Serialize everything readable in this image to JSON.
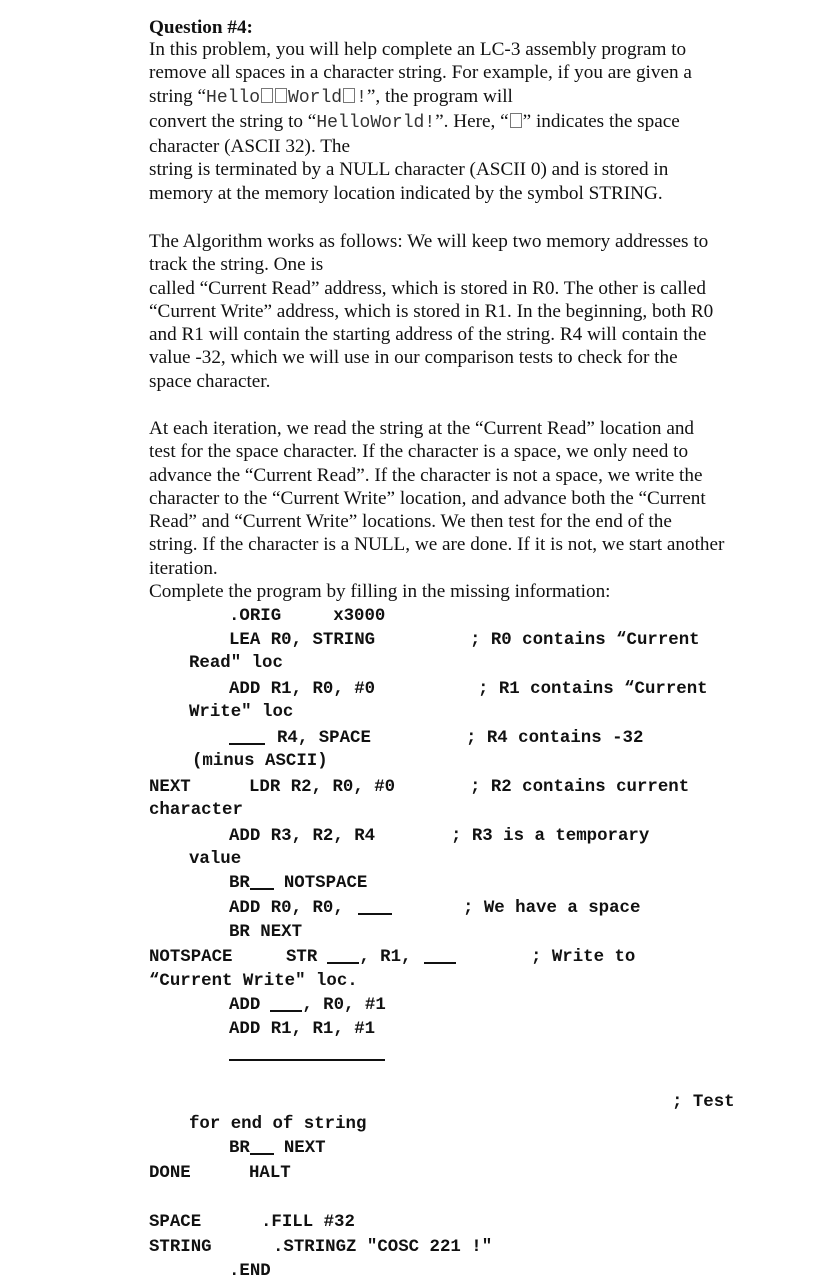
{
  "question": {
    "title": "Question #4:",
    "intro": {
      "line1": "In this problem, you will help complete an LC-3 assembly program to",
      "line2": "remove all spaces in a character string. For example, if you are given a",
      "line3_prefix": "string “",
      "example_input_hello": "Hello",
      "example_input_world": "World",
      "example_input_bang": "!",
      "line3_suffix": "”, the program will",
      "line4_prefix": "convert the string to “",
      "example_output": "HelloWorld!",
      "line4_mid": "”. Here, “",
      "line4_suffix": "” indicates the space",
      "line5": "character (ASCII 32). The",
      "line6": "string is terminated by a NULL character (ASCII 0) and is stored in",
      "line7": "memory at the memory location indicated by the symbol STRING."
    },
    "algorithm": [
      "The Algorithm works as follows: We will keep two memory addresses to",
      "track the string. One is",
      "called “Current Read” address, which is stored in R0. The other is called",
      "“Current Write” address, which is stored in R1. In the beginning, both R0",
      "and R1 will contain the starting address of the string. R4 will contain the",
      "value -32, which we will use in our comparison tests to check for the",
      "space character."
    ],
    "iteration": [
      "At each iteration, we read the string at the “Current Read” location and",
      "test for the space character. If the character is a space, we only need to",
      "advance the “Current Read”. If the character is not a space, we write the",
      "character to the “Current Write” location, and advance both the “Current",
      "Read” and “Current Write” locations. We then test for the end of the",
      "string. If the character is a NULL, we are done. If it is not, we start another",
      "iteration."
    ],
    "instruction": "Complete the program by filling in the missing information:"
  },
  "code": {
    "orig": ".ORIG",
    "orig_addr": "x3000",
    "lea": "LEA R0, STRING",
    "lea_comment": "; R0 contains “Current",
    "lea_comment_cont": "Read″ loc",
    "add_r1": "ADD R1, R0, #0",
    "add_r1_comment": "; R1 contains “Current",
    "add_r1_comment_cont": "Write″ loc",
    "ld_r4_operands": "R4, SPACE",
    "ld_r4_comment": "; R4 contains -32",
    "ld_r4_comment_cont": "(minus ASCII)",
    "next_label": "NEXT",
    "ldr": "LDR R2, R0, #0",
    "ldr_comment": "; R2 contains current",
    "ldr_comment_cont": "character",
    "add_r3": "ADD R3, R2, R4",
    "add_r3_comment": "; R3 is a temporary",
    "add_r3_comment_cont": "value",
    "br1_op": "BR",
    "br1_target": "NOTSPACE",
    "add_r0_prefix": "ADD R0, R0,",
    "add_r0_comment": "; We have a space",
    "br_next": "BR NEXT",
    "notspace_label": "NOTSPACE",
    "str_op": "STR",
    "str_mid": ", R1,",
    "str_comment": "; Write to",
    "str_comment_cont": "“Current Write″ loc.",
    "add_blank_op": "ADD",
    "add_blank_suffix": ", R0, #1",
    "add_r1_inc": "ADD R1, R1, #1",
    "test_comment": "; Test",
    "test_comment_cont": "for end of string",
    "br2_op": "BR",
    "br2_target": "NEXT",
    "done_label": "DONE",
    "halt": "HALT",
    "space_label": "SPACE",
    "fill": ".FILL #32",
    "string_label": "STRING",
    "stringz": ".STRINGZ \"COSC 221 !″",
    "end": ".END"
  }
}
